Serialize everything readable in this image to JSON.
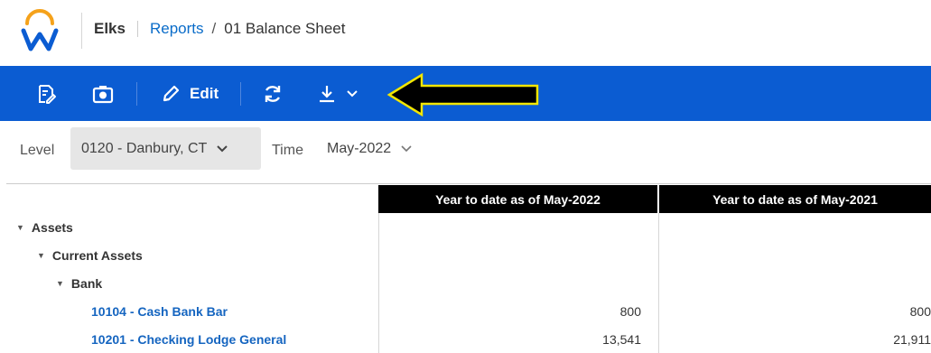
{
  "header": {
    "org": "Elks",
    "breadcrumb_link": "Reports",
    "separator": "/",
    "current_page": "01 Balance Sheet"
  },
  "toolbar": {
    "edit_label": "Edit",
    "icons": [
      "save-report-icon",
      "camera-icon",
      "pencil-icon",
      "refresh-icon",
      "download-icon",
      "chevron-down-icon"
    ],
    "background": "#0b5cd2"
  },
  "filters": {
    "level_label": "Level",
    "level_value": "0120 - Danbury, CT",
    "time_label": "Time",
    "time_value": "May-2022"
  },
  "table": {
    "columns": [
      "Year to date as of May-2022",
      "Year to date as of May-2021"
    ],
    "rows": [
      {
        "label": "Assets",
        "level": 0,
        "expandable": true,
        "link": false,
        "v1": "",
        "v2": ""
      },
      {
        "label": "Current Assets",
        "level": 1,
        "expandable": true,
        "link": false,
        "v1": "",
        "v2": ""
      },
      {
        "label": "Bank",
        "level": 2,
        "expandable": true,
        "link": false,
        "v1": "",
        "v2": ""
      },
      {
        "label": "10104 - Cash Bank Bar",
        "level": 3,
        "expandable": false,
        "link": true,
        "v1": "800",
        "v2": "800"
      },
      {
        "label": "10201 - Checking Lodge General",
        "level": 3,
        "expandable": false,
        "link": true,
        "v1": "13,541",
        "v2": "21,911"
      }
    ]
  },
  "annotation": {
    "arrow_fill": "#000000",
    "arrow_stroke": "#f2e600"
  }
}
